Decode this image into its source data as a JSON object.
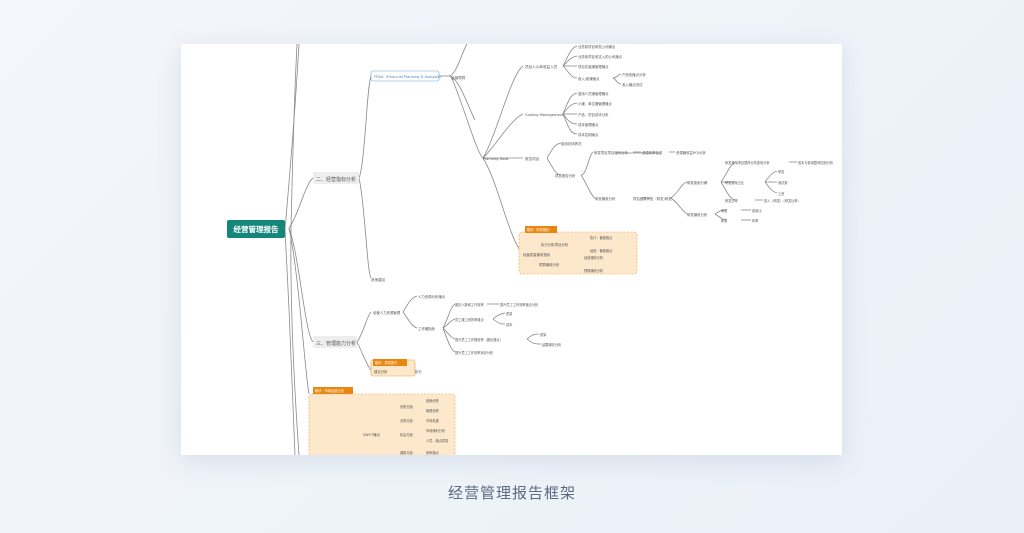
{
  "caption": "经营管理报告框架",
  "colors": {
    "root": "#14877a",
    "orange_fill": "#fde8cc",
    "orange_border": "#f0a040",
    "tag": "#e8860f",
    "line": "#7a7a7a",
    "fpa_border": "#6aa8d8"
  },
  "root": "经营管理报告",
  "sec2": "二、经营指标分析",
  "sec3": "三、管理能力分析",
  "fpa": "FP&A（Financial Planning & Analysis）",
  "fpa_child": "运营预算",
  "budget_a": "项目人么和收益人员",
  "budget_a_items": [
    "业务收项目研发公司赚点",
    "业务收项目收支入的公司赚点",
    "项目总量赚管理赚点",
    "收入/费赚管点"
  ],
  "budget_a_sub": [
    "产品收赚点分析",
    "收入赚点测试"
  ],
  "costing": "Costing Management",
  "costing_items": [
    "费用人员赚管理赚点",
    "小赚、单位赚管理赚点",
    "产品、项目成本分析",
    "成本管理赚点",
    "成本控制赚点"
  ],
  "planning": "Planning Tools",
  "report": "报告项目",
  "report_sub1": "费用总体情况",
  "report_sub2": "项目报告分析",
  "rp_a": "研发项目项目编号分析",
  "rp_a2": "资源效率信息",
  "rp_a3": "资源赚收益ROI分析",
  "rp_b": "研发赚收分析",
  "rp_b2": "项目结算状态（研发）",
  "rp_b3": "研发",
  "fee1": "研发费用分解",
  "fee1a": "研发费用项目整体分析费用分析",
  "fee1a2": "成本与费用整体控制分析",
  "fee1b": "研发费用占比",
  "fee1b_items": [
    "研发",
    "测试费",
    "工资"
  ],
  "fee1c": "研发比率",
  "fee1c2": "投入（研发）（研发比率）",
  "fee2": "研发赚收分析",
  "fee2a": "研发",
  "fee2a2": "费用比",
  "fee2b": "研发",
  "fee2b2": "利率",
  "tag_orange1": "模块：财务指标",
  "orange1_main": "经营质量赚收指标",
  "orange1_a": "执行分析项目分析",
  "orange1_a_items": [
    "执行：偏差赚点",
    "经营：偏差赚点"
  ],
  "orange1_b": "预算赚收分析",
  "orange1_b_items": [
    "经营赚收分析",
    "预算赚收分析"
  ],
  "other": "其他建议",
  "mgmt_a": "经营人力资源管理",
  "mgmt_a1": "人力资源分析赚点",
  "mgmt_a2": "工作赚指标",
  "mgmt_a2_items": [
    "团队人数和工作效率",
    "员工赚工资效率赚点",
    "提升员工工作赚效率（团队赚点）",
    "提升员工工作效率测评分析"
  ],
  "mgmt_a2_r1": "提升员工工作效率赚点分析",
  "mgmt_a2_r2": [
    "质量",
    "成本"
  ],
  "mgmt_a2_r3": [
    "质量",
    "结果赚收分析"
  ],
  "tag_orange2": "模块：质量提升",
  "mgmt_b": "建议分析",
  "mgmt_b1": "执行",
  "tag_orange3": "模块：市场运营计划",
  "swot": "SWOT赚点",
  "swot_a": "优势方面",
  "swot_a_items": [
    "营销优势",
    "管理优势"
  ],
  "swot_b": "劣势方面",
  "swot_b_items": [
    "市场机遇"
  ],
  "swot_c": "机会方面",
  "swot_c_items": [
    "市场赚利分析",
    "人员、赚点质量"
  ],
  "swot_d": "威胁方面",
  "swot_d_items": [
    "竞争赚点"
  ]
}
